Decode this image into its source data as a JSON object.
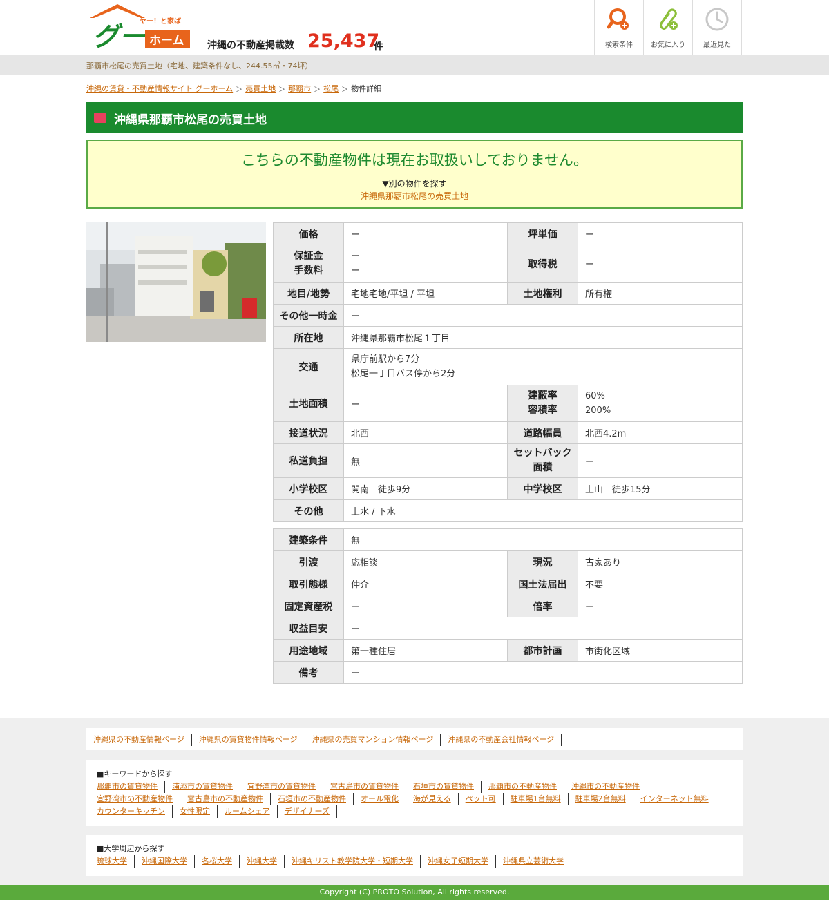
{
  "header": {
    "logo_tagline": "ヤー！と家ば",
    "logo_main": "グー",
    "logo_sub": "ホーム",
    "count_label": "沖縄の不動産掲載数",
    "count_value": "25,437",
    "count_unit": "件",
    "nav": [
      {
        "label": "検索条件",
        "icon": "search-plus-icon"
      },
      {
        "label": "お気に入り",
        "icon": "favorite-clip-icon"
      },
      {
        "label": "最近見た",
        "icon": "clock-icon"
      }
    ]
  },
  "subbar_text": "那覇市松尾の売買土地（宅地、建築条件なし、244.55㎡・74坪）",
  "breadcrumb": [
    "沖縄の賃貸・不動産情報サイト グーホーム",
    "売買土地",
    "那覇市",
    "松尾",
    "物件詳細"
  ],
  "page_title": "沖縄県那覇市松尾の売買土地",
  "notice": {
    "main": "こちらの不動産物件は現在お取扱いしておりません。",
    "sub": "▼別の物件を探す",
    "link": "沖縄県那覇市松尾の売買土地"
  },
  "spec1": {
    "price_label": "価格",
    "price": "ー",
    "tsubo_price_label": "坪単価",
    "tsubo_price": "ー",
    "deposit_label": "保証金",
    "deposit": "ー",
    "fee_label": "手数料",
    "fee": "ー",
    "acq_tax_label": "取得税",
    "acq_tax": "ー",
    "land_type_label": "地目/地勢",
    "land_type": "宅地宅地/平坦 / 平坦",
    "land_right_label": "土地権利",
    "land_right": "所有権",
    "other_lump_label": "その他一時金",
    "other_lump": "ー",
    "address_label": "所在地",
    "address": "沖縄県那覇市松尾１丁目",
    "access_label": "交通",
    "access1": "県庁前駅から7分",
    "access2": "松尾一丁目バス停から2分",
    "land_area_label": "土地面積",
    "land_area": "ー",
    "bcr_label": "建蔽率",
    "bcr": "60%",
    "far_label": "容積率",
    "far": "200%",
    "road_label": "接道状況",
    "road": "北西",
    "road_width_label": "道路幅員",
    "road_width": "北西4.2m",
    "private_road_label": "私道負担",
    "private_road": "無",
    "setback_label1": "セットバック",
    "setback_label2": "面積",
    "setback": "ー",
    "elem_label": "小学校区",
    "elem": "開南　徒歩9分",
    "junior_label": "中学校区",
    "junior": "上山　徒歩15分",
    "other_label": "その他",
    "other": "上水 / 下水"
  },
  "spec2": {
    "build_cond_label": "建築条件",
    "build_cond": "無",
    "handover_label": "引渡",
    "handover": "応相談",
    "status_label": "現況",
    "status": "古家あり",
    "deal_label": "取引態様",
    "deal": "仲介",
    "land_law_label": "国土法届出",
    "land_law": "不要",
    "fixed_tax_label": "固定資産税",
    "fixed_tax": "ー",
    "ratio_label": "倍率",
    "ratio": "ー",
    "yield_label": "収益目安",
    "yield": "ー",
    "zoning_label": "用途地域",
    "zoning": "第一種住居",
    "city_plan_label": "都市計画",
    "city_plan": "市街化区域",
    "remarks_label": "備考",
    "remarks": "ー"
  },
  "footer": {
    "top_links": [
      "沖縄県の不動産情報ページ",
      "沖縄県の賃貸物件情報ページ",
      "沖縄県の売買マンション情報ページ",
      "沖縄県の不動産会社情報ページ"
    ],
    "keyword_head": "■キーワードから探す",
    "keyword_links": [
      "那覇市の賃貸物件",
      "浦添市の賃貸物件",
      "宜野湾市の賃貸物件",
      "宮古島市の賃貸物件",
      "石垣市の賃貸物件",
      "那覇市の不動産物件",
      "沖縄市の不動産物件",
      "宜野湾市の不動産物件",
      "宮古島市の不動産物件",
      "石垣市の不動産物件",
      "オール電化",
      "海が見える",
      "ペット可",
      "駐車場1台無料",
      "駐車場2台無料",
      "インターネット無料",
      "カウンターキッチン",
      "女性限定",
      "ルームシェア",
      "デザイナーズ"
    ],
    "univ_head": "■大学周辺から探す",
    "univ_links": [
      "琉球大学",
      "沖縄国際大学",
      "名桜大学",
      "沖縄大学",
      "沖縄キリスト教学院大学・短期大学",
      "沖縄女子短期大学",
      "沖縄県立芸術大学"
    ],
    "copyright": "Copyright (C) PROTO Solution, All rights reserved."
  },
  "colors": {
    "brand_green": "#1a8a2e",
    "accent_orange": "#e8641c",
    "count_red": "#e0301e",
    "notice_bg": "#ffffcc"
  }
}
